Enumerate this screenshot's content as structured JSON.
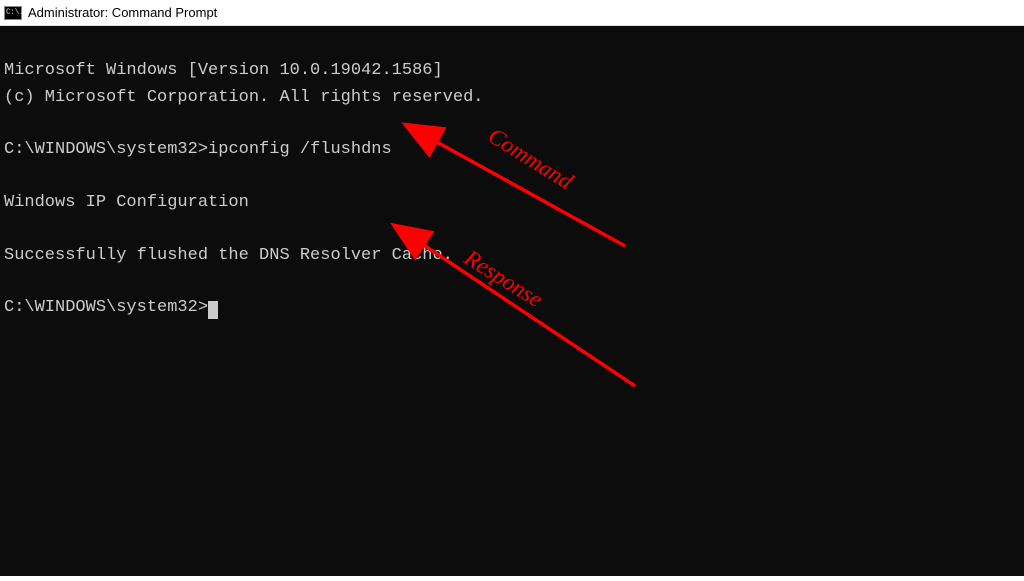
{
  "titlebar": {
    "icon_text": "C:\\.",
    "title": "Administrator: Command Prompt"
  },
  "terminal": {
    "line_version": "Microsoft Windows [Version 10.0.19042.1586]",
    "line_copyright": "(c) Microsoft Corporation. All rights reserved.",
    "prompt1_path": "C:\\WINDOWS\\system32>",
    "prompt1_command": "ipconfig /flushdns",
    "line_ipconfig_header": "Windows IP Configuration",
    "line_success": "Successfully flushed the DNS Resolver Cache.",
    "prompt2_path": "C:\\WINDOWS\\system32>"
  },
  "annotations": {
    "command_label": "Command",
    "response_label": "Response",
    "arrow_color": "#ff0000"
  }
}
